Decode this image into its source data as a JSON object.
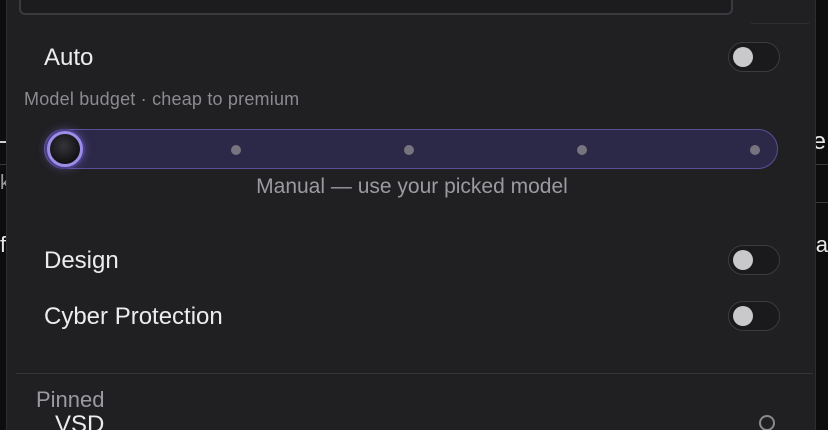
{
  "settings": {
    "auto": {
      "label": "Auto",
      "enabled": false
    },
    "design": {
      "label": "Design",
      "enabled": false
    },
    "cyber": {
      "label": "Cyber Protection",
      "enabled": false
    }
  },
  "budget": {
    "label": "Model budget · cheap to premium",
    "steps": 5,
    "selected_index": 0,
    "caption": "Manual — use your picked model"
  },
  "pinned": {
    "label": "Pinned",
    "first_item": "VSD"
  },
  "background": {
    "left_glyph_k": "k",
    "left_glyph_f": "f",
    "right_glyph_e": "e",
    "right_glyph_sa": "sa"
  },
  "colors": {
    "panel": "#202023",
    "accent": "#9c8ee6",
    "slider_track": "#2c2848",
    "text_primary": "#ececef",
    "text_muted": "#8b8b90"
  }
}
